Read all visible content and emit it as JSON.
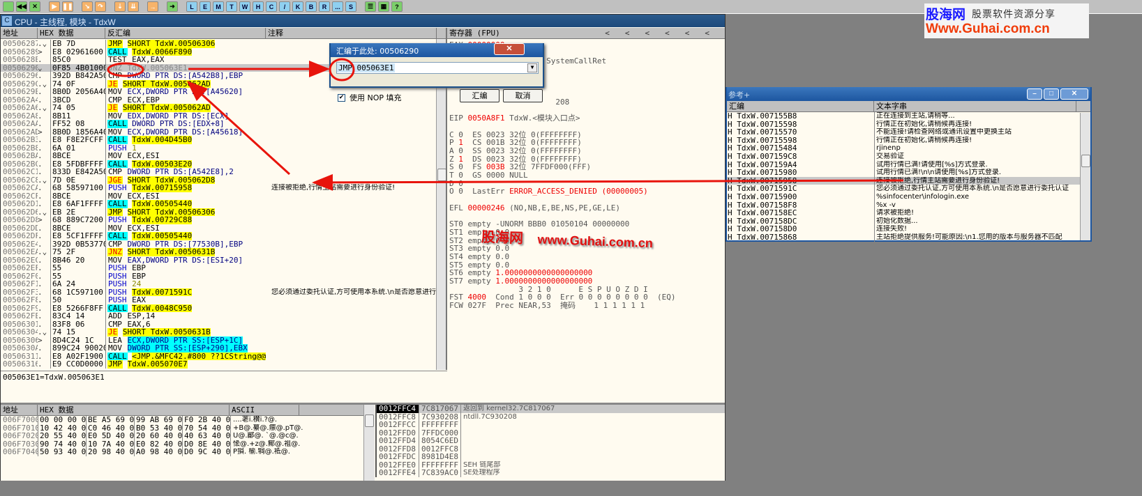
{
  "toolbar": {
    "buttons": [
      {
        "icon": "open-icon",
        "c": "g",
        "t": ""
      },
      {
        "icon": "rewind-icon",
        "c": "g",
        "t": "◀◀"
      },
      {
        "icon": "close-icon",
        "c": "g",
        "t": "✕"
      },
      {
        "gap": true
      },
      {
        "icon": "run-icon",
        "c": "o",
        "t": "▶"
      },
      {
        "icon": "pause-icon",
        "c": "o",
        "t": "❚❚"
      },
      {
        "gap": true
      },
      {
        "icon": "step-into-icon",
        "c": "o",
        "t": "↘"
      },
      {
        "icon": "step-over-icon",
        "c": "o",
        "t": "↷"
      },
      {
        "gap": true
      },
      {
        "icon": "trace-into-icon",
        "c": "o",
        "t": "⇣"
      },
      {
        "icon": "trace-over-icon",
        "c": "o",
        "t": "⇊"
      },
      {
        "gap": true
      },
      {
        "icon": "execute-till-return-icon",
        "c": "o",
        "t": "→"
      },
      {
        "gap": true
      },
      {
        "icon": "goto-icon",
        "c": "g",
        "t": "➜"
      },
      {
        "gap": true
      },
      {
        "icon": "",
        "c": "b",
        "t": "L"
      },
      {
        "icon": "",
        "c": "b",
        "t": "E"
      },
      {
        "icon": "",
        "c": "b",
        "t": "M"
      },
      {
        "icon": "",
        "c": "b",
        "t": "T"
      },
      {
        "icon": "",
        "c": "b",
        "t": "W"
      },
      {
        "icon": "",
        "c": "b",
        "t": "H"
      },
      {
        "icon": "",
        "c": "b",
        "t": "C"
      },
      {
        "icon": "",
        "c": "b",
        "t": "/"
      },
      {
        "icon": "",
        "c": "b",
        "t": "K"
      },
      {
        "icon": "",
        "c": "b",
        "t": "B"
      },
      {
        "icon": "",
        "c": "b",
        "t": "R"
      },
      {
        "icon": "",
        "c": "b",
        "t": "..."
      },
      {
        "icon": "",
        "c": "b",
        "t": "S"
      },
      {
        "gap": true
      },
      {
        "icon": "list-icon",
        "c": "g",
        "t": "☰"
      },
      {
        "icon": "grid-icon",
        "c": "g",
        "t": "▦"
      },
      {
        "icon": "help-icon",
        "c": "g",
        "t": "?"
      }
    ]
  },
  "cpu": {
    "title": "CPU - 主线程, 模块 - TdxW",
    "title_icon": "C",
    "disasm_headers": [
      "地址",
      "HEX 数据",
      "反汇编",
      "注释"
    ],
    "rows": [
      {
        "a": "00506287",
        "m": ".⌄",
        "h": "EB 7D",
        "op": "JMP",
        "arg": "SHORT TdxW.00506306",
        "k": "jmp",
        "hl": "y"
      },
      {
        "a": "00506289",
        "m": ">",
        "h": "E8 02961600",
        "op": "CALL",
        "arg": "TdxW.0066F890",
        "k": "call",
        "hl": "y"
      },
      {
        "a": "0050628E",
        "m": ".",
        "h": "85C0",
        "op": "TEST",
        "arg": "EAX,EAX",
        "k": "",
        "hl": ""
      },
      {
        "a": "00506290",
        "m": "⌄",
        "h": "0F85 4B010000",
        "op": "JNZ",
        "arg": "TdxW.005063E1",
        "k": "sel",
        "hl": ""
      },
      {
        "a": "00506296",
        "m": ".",
        "h": "392D B842A500",
        "op": "CMP",
        "arg": "DWORD PTR DS:[A542B8],EBP",
        "k": "",
        "hl": ""
      },
      {
        "a": "0050629C",
        "m": ".⌄",
        "h": "74 0F",
        "op": "JE",
        "arg": "SHORT TdxW.005062AD",
        "k": "jcc",
        "hl": "y"
      },
      {
        "a": "0050629E",
        "m": ".",
        "h": "8B0D 2056A400",
        "op": "MOV",
        "arg": "ECX,DWORD PTR DS:[A45620]",
        "k": "",
        "hl": ""
      },
      {
        "a": "005062A4",
        "m": ".",
        "h": "3BCD",
        "op": "CMP",
        "arg": "ECX,EBP",
        "k": "",
        "hl": ""
      },
      {
        "a": "005062A6",
        "m": ".⌄",
        "h": "74 05",
        "op": "JE",
        "arg": "SHORT TdxW.005062AD",
        "k": "jcc",
        "hl": "y"
      },
      {
        "a": "005062A8",
        "m": ".",
        "h": "8B11",
        "op": "MOV",
        "arg": "EDX,DWORD PTR DS:[ECX]",
        "k": "",
        "hl": ""
      },
      {
        "a": "005062AA",
        "m": ".",
        "h": "FF52 08",
        "op": "CALL",
        "arg": "DWORD PTR DS:[EDX+8]",
        "k": "call",
        "hl": ""
      },
      {
        "a": "005062AD",
        "m": ">",
        "h": "8B0D 1856A400",
        "op": "MOV",
        "arg": "ECX,DWORD PTR DS:[A45618]",
        "k": "",
        "hl": ""
      },
      {
        "a": "005062B3",
        "m": ".",
        "h": "E8 F8E2FCFF",
        "op": "CALL",
        "arg": "TdxW.004D45B0",
        "k": "call",
        "hl": "y"
      },
      {
        "a": "005062B8",
        "m": ".",
        "h": "6A 01",
        "op": "PUSH",
        "arg": "1",
        "k": "push",
        "hl": "n"
      },
      {
        "a": "005062BA",
        "m": ".",
        "h": "8BCE",
        "op": "MOV",
        "arg": "ECX,ESI",
        "k": "",
        "hl": ""
      },
      {
        "a": "005062BC",
        "m": ".",
        "h": "E8 5FDBFFFF",
        "op": "CALL",
        "arg": "TdxW.00503E20",
        "k": "call",
        "hl": "y"
      },
      {
        "a": "005062C1",
        "m": ".",
        "h": "833D E842A500",
        "op": "CMP",
        "arg": "DWORD PTR DS:[A542E8],2",
        "k": "",
        "hl": ""
      },
      {
        "a": "005062C8",
        "m": ".⌄",
        "h": "7D 0E",
        "op": "JGE",
        "arg": "SHORT TdxW.005062D8",
        "k": "jcc",
        "hl": "y"
      },
      {
        "a": "005062CA",
        "m": ".",
        "h": "68 58597100",
        "op": "PUSH",
        "arg": "TdxW.00715958",
        "k": "push",
        "hl": "y",
        "c": "连接被拒绝,行情主站需要进行身份验证!"
      },
      {
        "a": "005062CF",
        "m": ".",
        "h": "8BCE",
        "op": "MOV",
        "arg": "ECX,ESI",
        "k": "",
        "hl": ""
      },
      {
        "a": "005062D1",
        "m": ".",
        "h": "E8 6AF1FFFF",
        "op": "CALL",
        "arg": "TdxW.00505440",
        "k": "call",
        "hl": "y"
      },
      {
        "a": "005062D6",
        "m": ".⌄",
        "h": "EB 2E",
        "op": "JMP",
        "arg": "SHORT TdxW.00506306",
        "k": "jmp",
        "hl": "y"
      },
      {
        "a": "005062D8",
        "m": ">",
        "h": "68 889C7200",
        "op": "PUSH",
        "arg": "TdxW.00729C88",
        "k": "push",
        "hl": "y"
      },
      {
        "a": "005062DD",
        "m": ".",
        "h": "8BCE",
        "op": "MOV",
        "arg": "ECX,ESI",
        "k": "",
        "hl": ""
      },
      {
        "a": "005062DF",
        "m": ".",
        "h": "E8 5CF1FFFF",
        "op": "CALL",
        "arg": "TdxW.00505440",
        "k": "call",
        "hl": "y"
      },
      {
        "a": "005062E4",
        "m": ".",
        "h": "392D 0B537700",
        "op": "CMP",
        "arg": "DWORD PTR DS:[77530B],EBP",
        "k": "",
        "hl": ""
      },
      {
        "a": "005062EA",
        "m": ".⌄",
        "h": "75 2F",
        "op": "JNZ",
        "arg": "SHORT TdxW.0050631B",
        "k": "jcc",
        "hl": "y"
      },
      {
        "a": "005062EC",
        "m": ".",
        "h": "8B46 20",
        "op": "MOV",
        "arg": "EAX,DWORD PTR DS:[ESI+20]",
        "k": "",
        "hl": ""
      },
      {
        "a": "005062EF",
        "m": ".",
        "h": "55",
        "op": "PUSH",
        "arg": "EBP",
        "k": "push",
        "hl": ""
      },
      {
        "a": "005062F0",
        "m": ".",
        "h": "55",
        "op": "PUSH",
        "arg": "EBP",
        "k": "push",
        "hl": ""
      },
      {
        "a": "005062F1",
        "m": ".",
        "h": "6A 24",
        "op": "PUSH",
        "arg": "24",
        "k": "push",
        "hl": "n"
      },
      {
        "a": "005062F3",
        "m": ".",
        "h": "68 1C597100",
        "op": "PUSH",
        "arg": "TdxW.0071591C",
        "k": "push",
        "hl": "y",
        "c": "您必须通过委托认证,方可使用本系统.\\n是否愿意进行委托认证"
      },
      {
        "a": "005062F8",
        "m": ".",
        "h": "50",
        "op": "PUSH",
        "arg": "EAX",
        "k": "push",
        "hl": ""
      },
      {
        "a": "005062F9",
        "m": ".",
        "h": "E8 5266F8FF",
        "op": "CALL",
        "arg": "TdxW.0048C950",
        "k": "call",
        "hl": "y"
      },
      {
        "a": "005062FE",
        "m": ".",
        "h": "83C4 14",
        "op": "ADD",
        "arg": "ESP,14",
        "k": "",
        "hl": ""
      },
      {
        "a": "00506301",
        "m": ".",
        "h": "83F8 06",
        "op": "CMP",
        "arg": "EAX,6",
        "k": "",
        "hl": ""
      },
      {
        "a": "00506304",
        "m": ".⌄",
        "h": "74 15",
        "op": "JE",
        "arg": "SHORT TdxW.0050631B",
        "k": "jcc",
        "hl": "y"
      },
      {
        "a": "00506306",
        "m": ">",
        "h": "8D4C24 1C",
        "op": "LEA",
        "arg": "ECX,DWORD PTR SS:[ESP+1C]",
        "k": "",
        "hl": ""
      },
      {
        "a": "0050630A",
        "m": ".",
        "h": "899C24 90020000",
        "op": "MOV",
        "arg": "DWORD PTR SS:[ESP+290],EBX",
        "k": "",
        "hl": ""
      },
      {
        "a": "00506311",
        "m": ".",
        "h": "E8 A02F1900",
        "op": "CALL",
        "arg": "<JMP.&MFC42.#800_??1CString@@QAE@XZ>",
        "k": "call",
        "hl": "y"
      },
      {
        "a": "00506316",
        "m": ".",
        "h": "E9 CC0D0000",
        "op": "JMP",
        "arg": "TdxW.005070E7",
        "k": "jmp",
        "hl": "y"
      }
    ],
    "info_line": "005063E1=TdxW.005063E1",
    "registers_header": "寄存器 (FPU)",
    "registers": [
      {
        "t": "EAX ",
        "v": "00000000",
        "r": ""
      },
      {
        "t": "",
        "v": "",
        "r": ""
      },
      {
        "t": "                     SystemCallRet",
        "v": "",
        "r": ""
      },
      {
        "t": "",
        "v": "",
        "r": ""
      },
      {
        "t": "",
        "v": "",
        "r": ""
      },
      {
        "t": "",
        "v": "",
        "r": ""
      },
      {
        "t": "",
        "v": "",
        "r": ""
      },
      {
        "t": "                       208",
        "v": "",
        "r": ""
      },
      {
        "t": "",
        "v": "",
        "r": ""
      },
      {
        "t": "EIP ",
        "v": "0050A8F1",
        "r": " TdxW.<模块入口点>"
      },
      {
        "t": "",
        "v": "",
        "r": ""
      },
      {
        "t": "C 0  ES 0023 32位 0(FFFFFFFF)",
        "v": "",
        "r": ""
      },
      {
        "t": "P ",
        "v": "1",
        "r": "  CS 001B 32位 0(FFFFFFFF)"
      },
      {
        "t": "A 0  SS 0023 32位 0(FFFFFFFF)",
        "v": "",
        "r": ""
      },
      {
        "t": "Z ",
        "v": "1",
        "r": "  DS 0023 32位 0(FFFFFFFF)"
      },
      {
        "t": "S 0  FS ",
        "v": "003B",
        "r": " 32位 7FFDF000(FFF)"
      },
      {
        "t": "T 0  GS 0000 NULL",
        "v": "",
        "r": ""
      },
      {
        "t": "D 0",
        "v": "",
        "r": ""
      },
      {
        "t": "O 0  LastErr ",
        "v": "ERROR_ACCESS_DENIED (00000005)",
        "r": ""
      },
      {
        "t": "",
        "v": "",
        "r": ""
      },
      {
        "t": "EFL ",
        "v": "00000246",
        "r": " (NO,NB,E,BE,NS,PE,GE,LE)"
      },
      {
        "t": "",
        "v": "",
        "r": ""
      },
      {
        "t": "ST0 empty -UNORM BBB0 01050104 00000000",
        "v": "",
        "r": ""
      },
      {
        "t": "ST1 empty 0.0",
        "v": "",
        "r": ""
      },
      {
        "t": "ST2 empty 0.0",
        "v": "",
        "r": ""
      },
      {
        "t": "ST3 empty 0.0",
        "v": "",
        "r": ""
      },
      {
        "t": "ST4 empty 0.0",
        "v": "",
        "r": ""
      },
      {
        "t": "ST5 empty 0.0",
        "v": "",
        "r": ""
      },
      {
        "t": "ST6 empty ",
        "v": "1.0000000000000000000",
        "r": ""
      },
      {
        "t": "ST7 empty ",
        "v": "1.0000000000000000000",
        "r": ""
      },
      {
        "t": "               3 2 1 0      E S P U O Z D I",
        "v": "",
        "r": ""
      },
      {
        "t": "FST ",
        "v": "4000",
        "r": "  Cond 1 0 0 0  Err 0 0 0 0 0 0 0 0  (EQ)"
      },
      {
        "t": "FCW 027F  Prec NEAR,53  掩码    1 1 1 1 1 1",
        "v": "",
        "r": ""
      }
    ],
    "dump_headers": [
      "地址",
      "HEX 数据",
      "ASCII"
    ],
    "dump": [
      {
        "a": "006F7000",
        "h": [
          "00 00 00 00",
          "BE A5 69 00",
          "99 AB 69 00",
          "F0 2B 40 00"
        ],
        "s": "....荖i.櫕i.?@."
      },
      {
        "a": "006F7010",
        "h": [
          "10 42 40 00",
          "C0 46 40 00",
          "B0 53 40 00",
          "70 54 40 00"
        ],
        "s": "+B@.繤@.癝@.pT@."
      },
      {
        "a": "006F7020",
        "h": [
          "20 55 40 00",
          "E0 5D 40 00",
          "20 60 40 00",
          "40 63 40 00"
        ],
        "s": " U@.郿@. `@.@c@."
      },
      {
        "a": "006F7030",
        "h": [
          "90 74 40 00",
          "10 7A 40 00",
          "E0 82 40 00",
          "D0 8E 40 00"
        ],
        "s": "恡@.+z@.鄦@.袓@."
      },
      {
        "a": "006F7040",
        "h": [
          "50 93 40 00",
          "20 98 40 00",
          "A0 98 40 00",
          "D0 9C 40 00"
        ],
        "s": "P損. 榆.犅@.袛@."
      }
    ],
    "stack": [
      {
        "a": "0012FFC4",
        "v": "7C817067",
        "c": "返回到 kernel32.7C817067"
      },
      {
        "a": "0012FFC8",
        "v": "7C930208",
        "c": "ntdll.7C930208"
      },
      {
        "a": "0012FFCC",
        "v": "FFFFFFFF",
        "c": ""
      },
      {
        "a": "0012FFD0",
        "v": "7FFDC000",
        "c": ""
      },
      {
        "a": "0012FFD4",
        "v": "8054C6ED",
        "c": ""
      },
      {
        "a": "0012FFD8",
        "v": "0012FFC8",
        "c": ""
      },
      {
        "a": "0012FFDC",
        "v": "8981D4E8",
        "c": ""
      },
      {
        "a": "0012FFE0",
        "v": "FFFFFFFF",
        "c": "SEH 链尾部"
      },
      {
        "a": "0012FFE4",
        "v": "7C839AC0",
        "c": "SE处理程序"
      }
    ]
  },
  "dialog": {
    "title": "汇编于此处: 00506290",
    "input": "JMP 005063E1",
    "checkbox_label": "使用 NOP 填充",
    "checked": true,
    "ok": "汇编",
    "cancel": "取消"
  },
  "refs": {
    "title": "参考+",
    "headers": [
      "汇编",
      "文本字串"
    ],
    "rows": [
      [
        "H TdxW.007155B8",
        "正在连接到主站,请稍等..."
      ],
      [
        "H TdxW.00715598",
        "行情正在初始化,请稍候再连接!"
      ],
      [
        "H TdxW.00715570",
        "不能连接!请检查网络或通讯设置中更换主站"
      ],
      [
        "H TdxW.00715598",
        "行情正在初始化,请稍候再连接!"
      ],
      [
        "H TdxW.00715484",
        "rjinenp"
      ],
      [
        "H TdxW.007159C8",
        "交易验证"
      ],
      [
        "H TdxW.007159A4",
        "试用行情已满!请使用[%s]方式登录."
      ],
      [
        "H TdxW.00715980",
        "试用行情已满!\\n\\n请使用[%s]方式登录."
      ],
      [
        "H TdxW.00715958",
        "连接被拒绝,行情主站需要进行身份验证!"
      ],
      [
        "H TdxW.0071591C",
        "您必须通过委托认证,方可使用本系统.\\n是否愿意进行委托认证"
      ],
      [
        "H TdxW.00715900",
        "%sinfocenter\\infologin.exe"
      ],
      [
        "H TdxW.007158F8",
        "%x -v"
      ],
      [
        "H TdxW.007158EC",
        "请求被拒绝!"
      ],
      [
        "H TdxW.007158DC",
        "初始化数据..."
      ],
      [
        "H TdxW.007158D0",
        "连接失败!"
      ],
      [
        "H TdxW.00715868",
        "主站拒绝提供服务!可能原因:\\n1.您用的版本与服务器不匹配"
      ]
    ],
    "selected": 8
  },
  "logo": {
    "cn": "股海网",
    "tagline": "股票软件资源分享",
    "url": "Www.Guhai.com.cn"
  },
  "watermark": {
    "cn": "股海网",
    "url": "www.Guhai.com.cn"
  }
}
